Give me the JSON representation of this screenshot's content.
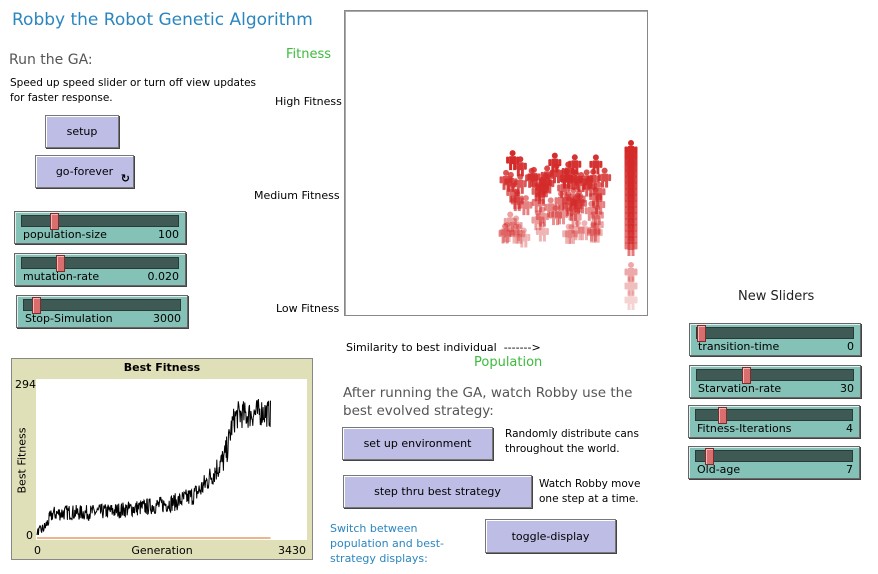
{
  "title": "Robby the Robot Genetic Algorithm",
  "run_section": {
    "heading": "Run the GA:",
    "help": "Speed up speed slider or turn off view updates for faster response.",
    "setup_label": "setup",
    "go_forever_label": "go-forever",
    "forever_icon": "↻"
  },
  "view_labels": {
    "fitness": "Fitness",
    "high": "High Fitness",
    "medium": "Medium Fitness",
    "low": "Low Fitness",
    "similarity": "Similarity to best individual  ------->",
    "population": "Population"
  },
  "sliders": [
    {
      "label": "population-size",
      "value": "100",
      "level": 0.18
    },
    {
      "label": "mutation-rate",
      "value": "0.020",
      "level": 0.22
    },
    {
      "label": "Stop-Simulation",
      "value": "3000",
      "level": 0.05
    }
  ],
  "new_sliders": {
    "heading": "New Sliders",
    "items": [
      {
        "label": "transition-time",
        "value": "0",
        "level": 0.0
      },
      {
        "label": "Starvation-rate",
        "value": "30",
        "level": 0.29
      },
      {
        "label": "Fitness-Iterations",
        "value": "4",
        "level": 0.14
      },
      {
        "label": "Old-age",
        "value": "7",
        "level": 0.06
      }
    ]
  },
  "strategy_section": {
    "intro": "After running the GA, watch Robby use the best evolved strategy:",
    "setup_env_label": "set up environment",
    "setup_env_note": "Randomly distribute cans throughout the world.",
    "step_label": "step thru best strategy",
    "step_note": "Watch Robby move one step at a time.",
    "switch_note": "Switch between population and best-strategy displays:",
    "toggle_label": "toggle-display"
  },
  "colors": {
    "agent": "#d42a2a",
    "plot_line": "#000000",
    "zero_line": "#e06a1a",
    "button": "#bdbde6",
    "slider": "#84c1b7"
  },
  "chart_data": {
    "type": "line",
    "title": "Best Fitness",
    "xlabel": "Generation",
    "ylabel": "Best Fitness",
    "xlim": [
      0,
      3430
    ],
    "ylim": [
      0,
      294
    ],
    "x_tick_labels": [
      "0",
      "3430"
    ],
    "y_tick_labels": [
      "0",
      "294"
    ],
    "series": [
      {
        "x": [
          0,
          100,
          200,
          400,
          600,
          800,
          1000,
          1200,
          1400,
          1600,
          1800,
          2000,
          2100,
          2200,
          2300,
          2400,
          2450,
          2500,
          2550,
          2600,
          2700,
          2800,
          2900,
          3000
        ],
        "values": [
          3,
          15,
          42,
          45,
          44,
          46,
          48,
          52,
          56,
          60,
          66,
          78,
          90,
          110,
          130,
          150,
          175,
          215,
          235,
          240,
          238,
          242,
          245,
          240
        ]
      },
      {
        "x": [
          0,
          3000
        ],
        "values": [
          0,
          0
        ]
      }
    ]
  }
}
